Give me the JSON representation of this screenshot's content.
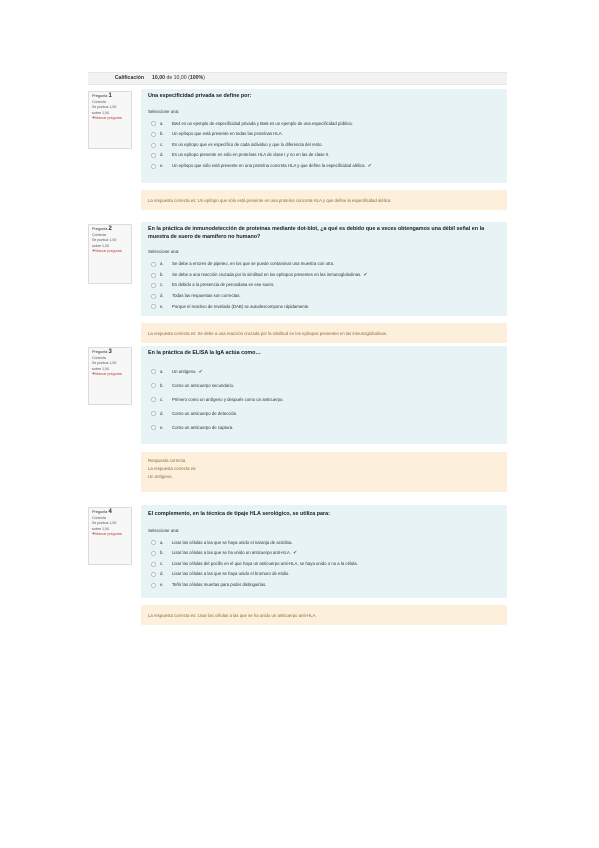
{
  "grade": {
    "label": "Calificación",
    "score": "10,00",
    "of_text": "de 10,00 (",
    "percent": "100%",
    "close": ")"
  },
  "questions": [
    {
      "label": "Pregunta",
      "number": "1",
      "status": "Correcta",
      "score_line1": "Se puntúa 1,00",
      "score_line2": "sobre 1,00",
      "flag": "Marcar pregunta",
      "text": "Una especificidad privada se define por:",
      "prompt": "Seleccione una:",
      "answers": [
        {
          "letter": "a.",
          "text": "Bw4 es un ejemplo de especificidad privada y Bw6 es un ejemplo de una especificidad pública.",
          "check": ""
        },
        {
          "letter": "b.",
          "text": "Un epítopo que está presente en todas las proteínas HLA.",
          "check": ""
        },
        {
          "letter": "c.",
          "text": "Es un epítopo que es específico de cada individuo y que lo diferencia del resto.",
          "check": ""
        },
        {
          "letter": "d.",
          "text": "Es un epítopo presente en sólo en  proteínas HLA de clase I y no en las de clase II.",
          "check": ""
        },
        {
          "letter": "e.",
          "text": "Un epítopo que sólo está presente en una proteína concreta HLA y que define la especificidad alélica.",
          "check": "✔"
        }
      ],
      "feedback": [
        "La respuesta correcta es: Un epítopo que sólo está presente en una proteína concreta HLA y que define la especificidad alélica."
      ]
    },
    {
      "label": "Pregunta",
      "number": "2",
      "status": "Correcta",
      "score_line1": "Se puntúa 1,00",
      "score_line2": "sobre 1,00",
      "flag": "Marcar pregunta",
      "text": "En la práctica de inmunodetección de proteínas mediante dot-blot, ¿a qué es debido que a veces obtengamos una débil señal en la muestra de suero de mamífero no humano?",
      "prompt": "Seleccione una:",
      "answers": [
        {
          "letter": "a.",
          "text": "Se debe a errores de pipeteo, en los que se puede contaminar una muestra con otra.",
          "check": ""
        },
        {
          "letter": "b.",
          "text": "Se debe a una reacción cruzada por la similitud en los epítopos presentes en las inmunoglobulinas.",
          "check": "✔"
        },
        {
          "letter": "c.",
          "text": "Es debido a la presencia de peroxidasa en ese suero.",
          "check": ""
        },
        {
          "letter": "d.",
          "text": "Todas las respuestas son correctas.",
          "check": ""
        },
        {
          "letter": "e.",
          "text": "Porque el reactivo de revelado (DAB) se autodescompone rápidamente.",
          "check": ""
        }
      ],
      "feedback": [
        "La respuesta correcta es: Se debe a una reacción cruzada por la similitud en los epítopos presentes en las inmunoglobulinas."
      ]
    },
    {
      "label": "Pregunta",
      "number": "3",
      "status": "Correcta",
      "score_line1": "Se puntúa 1,00",
      "score_line2": "sobre 1,00",
      "flag": "Marcar pregunta",
      "text": "En la práctica de ELISA la IgA actúa como…",
      "prompt": "",
      "answers": [
        {
          "letter": "a.",
          "text": "Un antígeno.",
          "check": "✔"
        },
        {
          "letter": "b.",
          "text": "Como un anticuerpo secundario.",
          "check": ""
        },
        {
          "letter": "c.",
          "text": "Primero como un antígeno y después como un anticuerpo.",
          "check": ""
        },
        {
          "letter": "d.",
          "text": "Como un anticuerpo de detección.",
          "check": ""
        },
        {
          "letter": "e.",
          "text": "Como un anticuerpo de captura.",
          "check": ""
        }
      ],
      "feedback": [
        "Respuesta correcta",
        "La respuesta correcta es:",
        "Un antígeno."
      ]
    },
    {
      "label": "Pregunta",
      "number": "4",
      "status": "Correcta",
      "score_line1": "Se puntúa 1,00",
      "score_line2": "sobre 1,00",
      "flag": "Marcar pregunta",
      "text": "El complemento, en la técnica de tipaje HLA serológico, se utiliza para:",
      "prompt": "Seleccione una:",
      "answers": [
        {
          "letter": "a.",
          "text": "Lisar las células a las que se haya unido el naranja de acridina.",
          "check": ""
        },
        {
          "letter": "b.",
          "text": "Lisar las células a las que se ha unido un anticuerpo anti-HLA.",
          "check": "✔"
        },
        {
          "letter": "c.",
          "text": "Lisar las células del pocillo en el que haya un anticuerpo anti-HLA, se haya unido o no a la célula.",
          "check": ""
        },
        {
          "letter": "d.",
          "text": "Lisar las células a las que se haya unido el bromuro de etidio.",
          "check": ""
        },
        {
          "letter": "e.",
          "text": "Teñir las células muertas para poder distinguirlas.",
          "check": ""
        }
      ],
      "feedback": [
        "La respuesta correcta es: Lisar las células a las que se ha unido un anticuerpo anti-HLA."
      ]
    }
  ]
}
